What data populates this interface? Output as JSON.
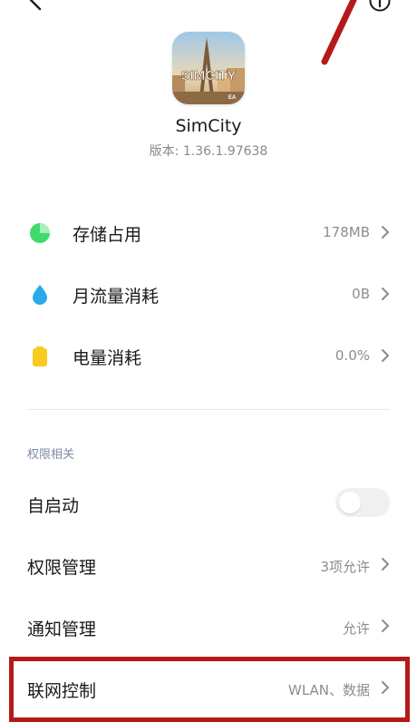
{
  "app": {
    "icon_text": "SIMCITY",
    "icon_badge": "EA",
    "name": "SimCity",
    "version": "版本: 1.36.1.97638"
  },
  "stats": [
    {
      "label": "存储占用",
      "value": "178MB",
      "icon": "pie-chart-icon",
      "color": "#3ddc6b"
    },
    {
      "label": "月流量消耗",
      "value": "0B",
      "icon": "water-drop-icon",
      "color": "#2aa9e8"
    },
    {
      "label": "电量消耗",
      "value": "0.0%",
      "icon": "battery-icon",
      "color": "#f7cc1d"
    }
  ],
  "permissions": {
    "section_title": "权限相关",
    "autostart": {
      "label": "自启动",
      "enabled": false
    },
    "permission_mgmt": {
      "label": "权限管理",
      "value": "3项允许"
    },
    "notification_mgmt": {
      "label": "通知管理",
      "value": "允许"
    },
    "network_control": {
      "label": "联网控制",
      "value": "WLAN、数据"
    }
  },
  "colors": {
    "accent_annotation": "#b51a1a",
    "secondary_text": "#8c8c8c",
    "section_title": "#7f8aa3"
  }
}
